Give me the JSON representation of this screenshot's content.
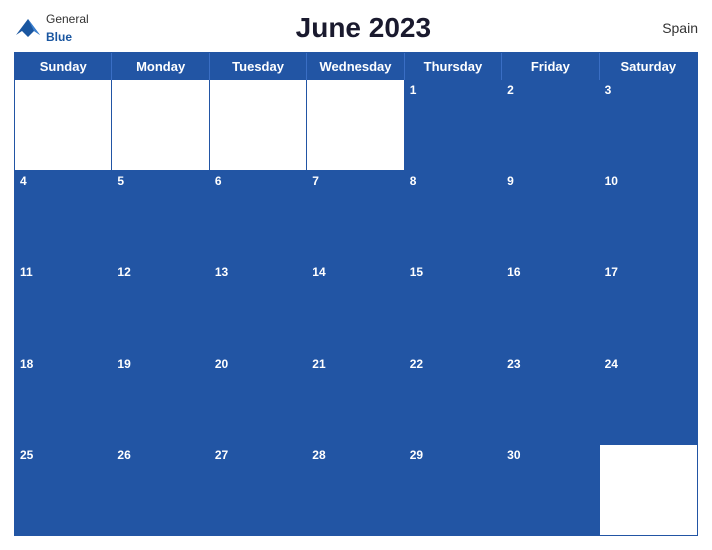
{
  "header": {
    "logo": {
      "general": "General",
      "blue": "Blue"
    },
    "title": "June 2023",
    "country": "Spain"
  },
  "calendar": {
    "day_headers": [
      "Sunday",
      "Monday",
      "Tuesday",
      "Wednesday",
      "Thursday",
      "Friday",
      "Saturday"
    ],
    "weeks": [
      [
        {
          "day": "",
          "type": "empty"
        },
        {
          "day": "",
          "type": "empty"
        },
        {
          "day": "",
          "type": "empty"
        },
        {
          "day": "",
          "type": "empty"
        },
        {
          "day": "1",
          "type": "header-blue"
        },
        {
          "day": "2",
          "type": "header-blue"
        },
        {
          "day": "3",
          "type": "header-blue"
        }
      ],
      [
        {
          "day": "4",
          "type": "header-blue"
        },
        {
          "day": "5",
          "type": "header-blue"
        },
        {
          "day": "6",
          "type": "header-blue"
        },
        {
          "day": "7",
          "type": "header-blue"
        },
        {
          "day": "8",
          "type": "header-blue"
        },
        {
          "day": "9",
          "type": "header-blue"
        },
        {
          "day": "10",
          "type": "header-blue"
        }
      ],
      [
        {
          "day": "11",
          "type": "header-blue"
        },
        {
          "day": "12",
          "type": "header-blue"
        },
        {
          "day": "13",
          "type": "header-blue"
        },
        {
          "day": "14",
          "type": "header-blue"
        },
        {
          "day": "15",
          "type": "header-blue"
        },
        {
          "day": "16",
          "type": "header-blue"
        },
        {
          "day": "17",
          "type": "header-blue"
        }
      ],
      [
        {
          "day": "18",
          "type": "header-blue"
        },
        {
          "day": "19",
          "type": "header-blue"
        },
        {
          "day": "20",
          "type": "header-blue"
        },
        {
          "day": "21",
          "type": "header-blue"
        },
        {
          "day": "22",
          "type": "header-blue"
        },
        {
          "day": "23",
          "type": "header-blue"
        },
        {
          "day": "24",
          "type": "header-blue"
        }
      ],
      [
        {
          "day": "25",
          "type": "header-blue"
        },
        {
          "day": "26",
          "type": "header-blue"
        },
        {
          "day": "27",
          "type": "header-blue"
        },
        {
          "day": "28",
          "type": "header-blue"
        },
        {
          "day": "29",
          "type": "header-blue"
        },
        {
          "day": "30",
          "type": "header-blue"
        },
        {
          "day": "",
          "type": "empty"
        }
      ]
    ]
  }
}
